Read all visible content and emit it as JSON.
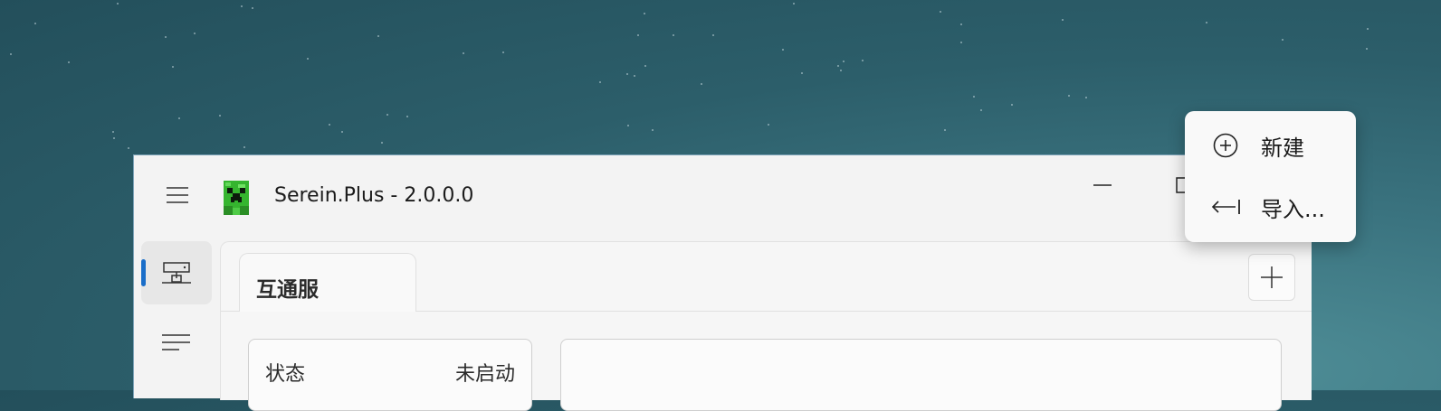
{
  "window": {
    "title": "Serein.Plus - 2.0.0.0"
  },
  "tabs": [
    {
      "label": "互通服"
    }
  ],
  "status_card": {
    "label": "状态",
    "value": "未启动"
  },
  "flyout_menu": {
    "items": [
      {
        "label": "新建",
        "icon": "add-circle-icon"
      },
      {
        "label": "导入...",
        "icon": "import-arrow-icon"
      }
    ]
  },
  "colors": {
    "accent": "#1a6ec9",
    "window_bg": "#f3f3f3",
    "app_icon_green": "#3ec43a"
  }
}
